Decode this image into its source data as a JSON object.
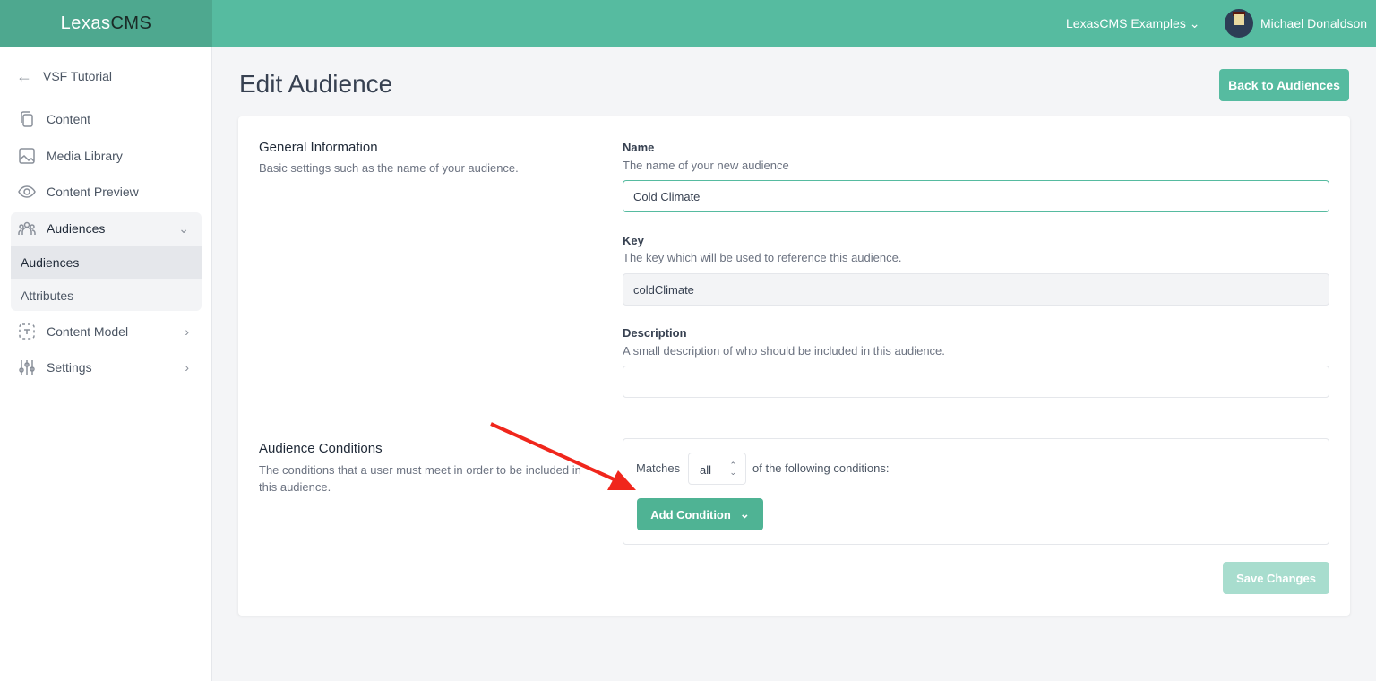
{
  "brand": {
    "name_light": "Lexas",
    "name_dark": "CMS",
    "accent": "#56bba0"
  },
  "topbar": {
    "project": "LexasCMS Examples",
    "user": "Michael Donaldson"
  },
  "sidebar": {
    "back": "VSF Tutorial",
    "items": [
      {
        "label": "Content",
        "icon": "copy-icon"
      },
      {
        "label": "Media Library",
        "icon": "image-icon"
      },
      {
        "label": "Content Preview",
        "icon": "eye-icon"
      },
      {
        "label": "Audiences",
        "icon": "users-icon"
      },
      {
        "label": "Content Model",
        "icon": "model-icon"
      },
      {
        "label": "Settings",
        "icon": "sliders-icon"
      }
    ],
    "sub": [
      "Audiences",
      "Attributes"
    ]
  },
  "page": {
    "title": "Edit Audience",
    "back_button": "Back to Audiences"
  },
  "general": {
    "title": "General Information",
    "desc": "Basic settings such as the name of your audience.",
    "name_label": "Name",
    "name_hint": "The name of your new audience",
    "name_value": "Cold Climate",
    "key_label": "Key",
    "key_hint": "The key which will be used to reference this audience.",
    "key_value": "coldClimate",
    "desc_label": "Description",
    "desc_hint": "A small description of who should be included in this audience.",
    "desc_value": ""
  },
  "conditions": {
    "title": "Audience Conditions",
    "desc": "The conditions that a user must meet in order to be included in this audience.",
    "matches": "Matches",
    "match_value": "all",
    "suffix": "of the following conditions:",
    "add_button": "Add Condition"
  },
  "save_button": "Save Changes"
}
